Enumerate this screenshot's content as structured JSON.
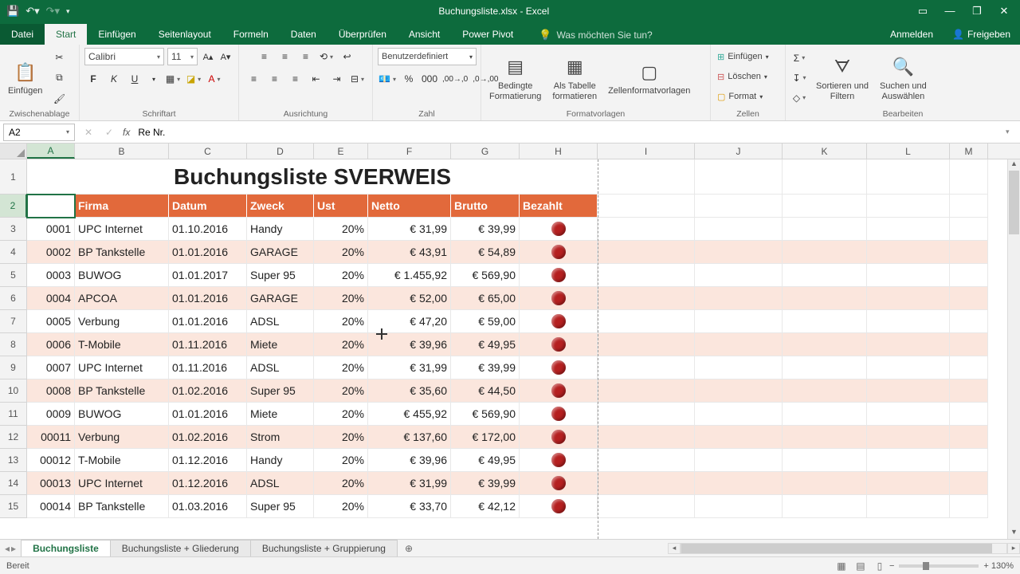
{
  "titlebar": {
    "title": "Buchungsliste.xlsx - Excel"
  },
  "tabs": {
    "file": "Datei",
    "start": "Start",
    "insert": "Einfügen",
    "layout": "Seitenlayout",
    "formulas": "Formeln",
    "data": "Daten",
    "review": "Überprüfen",
    "view": "Ansicht",
    "powerpivot": "Power Pivot",
    "tellme": "Was möchten Sie tun?",
    "signin": "Anmelden",
    "share": "Freigeben"
  },
  "ribbon": {
    "clipboard": {
      "paste": "Einfügen",
      "label": "Zwischenablage"
    },
    "font": {
      "name": "Calibri",
      "size": "11",
      "label": "Schriftart"
    },
    "align": {
      "label": "Ausrichtung"
    },
    "number": {
      "format": "Benutzerdefiniert",
      "label": "Zahl"
    },
    "styles": {
      "cond": "Bedingte\nFormatierung",
      "table": "Als Tabelle\nformatieren",
      "cellstyle": "Zellenformatvorlagen",
      "label": "Formatvorlagen"
    },
    "cells": {
      "insert": "Einfügen",
      "delete": "Löschen",
      "format": "Format",
      "label": "Zellen"
    },
    "editing": {
      "sortfilter": "Sortieren und\nFiltern",
      "findselect": "Suchen und\nAuswählen",
      "label": "Bearbeiten"
    }
  },
  "namebox": "A2",
  "formula": "Re Nr.",
  "columns": [
    "A",
    "B",
    "C",
    "D",
    "E",
    "F",
    "G",
    "H",
    "I",
    "J",
    "K",
    "L",
    "M"
  ],
  "title_row": "Buchungsliste SVERWEIS",
  "headers": [
    "Re Nr.",
    "Firma",
    "Datum",
    "Zweck",
    "Ust",
    "Netto",
    "Brutto",
    "Bezahlt"
  ],
  "chart_data": {
    "type": "table",
    "columns": [
      "Re Nr.",
      "Firma",
      "Datum",
      "Zweck",
      "Ust",
      "Netto",
      "Brutto",
      "Bezahlt"
    ],
    "rows": [
      [
        "0001",
        "UPC Internet",
        "01.10.2016",
        "Handy",
        "20%",
        "€      31,99",
        "€ 39,99",
        "unpaid"
      ],
      [
        "0002",
        "BP Tankstelle",
        "01.01.2016",
        "GARAGE",
        "20%",
        "€      43,91",
        "€ 54,89",
        "unpaid"
      ],
      [
        "0003",
        "BUWOG",
        "01.01.2017",
        "Super 95",
        "20%",
        "€ 1.455,92",
        "€ 569,90",
        "unpaid"
      ],
      [
        "0004",
        "APCOA",
        "01.01.2016",
        "GARAGE",
        "20%",
        "€      52,00",
        "€ 65,00",
        "unpaid"
      ],
      [
        "0005",
        "Verbung",
        "01.01.2016",
        "ADSL",
        "20%",
        "€      47,20",
        "€ 59,00",
        "unpaid"
      ],
      [
        "0006",
        "T-Mobile",
        "01.11.2016",
        "Miete",
        "20%",
        "€      39,96",
        "€ 49,95",
        "unpaid"
      ],
      [
        "0007",
        "UPC Internet",
        "01.11.2016",
        "ADSL",
        "20%",
        "€      31,99",
        "€ 39,99",
        "unpaid"
      ],
      [
        "0008",
        "BP Tankstelle",
        "01.02.2016",
        "Super 95",
        "20%",
        "€      35,60",
        "€ 44,50",
        "unpaid"
      ],
      [
        "0009",
        "BUWOG",
        "01.01.2016",
        "Miete",
        "20%",
        "€    455,92",
        "€ 569,90",
        "unpaid"
      ],
      [
        "00011",
        "Verbung",
        "01.02.2016",
        "Strom",
        "20%",
        "€    137,60",
        "€ 172,00",
        "unpaid"
      ],
      [
        "00012",
        "T-Mobile",
        "01.12.2016",
        "Handy",
        "20%",
        "€      39,96",
        "€ 49,95",
        "unpaid"
      ],
      [
        "00013",
        "UPC Internet",
        "01.12.2016",
        "ADSL",
        "20%",
        "€      31,99",
        "€ 39,99",
        "unpaid"
      ],
      [
        "00014",
        "BP Tankstelle",
        "01.03.2016",
        "Super 95",
        "20%",
        "€      33,70",
        "€ 42,12",
        "unpaid"
      ]
    ]
  },
  "sheets": {
    "nav_prev": "◂",
    "nav_next": "▸",
    "s1": "Buchungsliste",
    "s2": "Buchungsliste + Gliederung",
    "s3": "Buchungsliste + Gruppierung",
    "add": "⊕"
  },
  "status": {
    "ready": "Bereit",
    "zoom": "+ 130%"
  }
}
